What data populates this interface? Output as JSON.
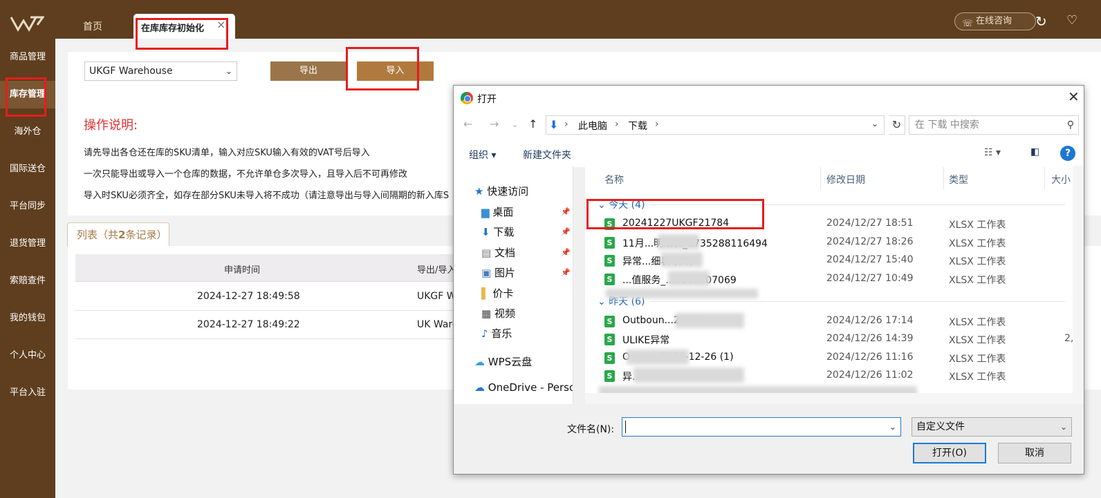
{
  "sidebar": {
    "items": [
      {
        "label": "商品管理"
      },
      {
        "label": "库存管理"
      },
      {
        "label": "海外仓"
      },
      {
        "label": "国际送仓"
      },
      {
        "label": "平台同步"
      },
      {
        "label": "退货管理"
      },
      {
        "label": "索赔查件"
      },
      {
        "label": "我的钱包"
      },
      {
        "label": "个人中心"
      },
      {
        "label": "平台入驻"
      }
    ]
  },
  "topbar": {
    "tab_home": "首页",
    "tab_active": "在库库存初始化",
    "tab_close": "×",
    "consult": "在线咨询"
  },
  "toolbar": {
    "warehouse": "UKGF Warehouse",
    "export_label": "导出",
    "import_label": "导入"
  },
  "instructions": {
    "title": "操作说明:",
    "lines": [
      "请先导出各仓还在库的SKU清单，输入对应SKU输入有效的VAT号后导入",
      "一次只能导出或导入一个仓库的数据，不允许单仓多次导入，且导入后不可再修改",
      "导入时SKU必须齐全，如存在部分SKU未导入将不成功（请注意导出与导入间隔期的新入库S"
    ]
  },
  "list": {
    "tab_prefix": "列表（共",
    "count": "2",
    "tab_suffix": "条记录）",
    "headers": [
      "申请时间",
      "导出/导入"
    ],
    "rows": [
      {
        "time": "2024-12-27 18:49:58",
        "warehouse": "UKGF W"
      },
      {
        "time": "2024-12-27 18:49:22",
        "warehouse": "UK Ware"
      }
    ]
  },
  "dialog": {
    "title": "打开",
    "path": [
      "此电脑",
      "下载"
    ],
    "search_placeholder": "在 下载 中搜索",
    "organize": "组织 ▾",
    "new_folder": "新建文件夹",
    "nav": {
      "quick_access": "快速访问",
      "items": [
        "桌面",
        "下载",
        "文档",
        "图片",
        "价卡",
        "视频",
        "音乐"
      ],
      "wps": "WPS云盘",
      "onedrive": "OneDrive - Perso"
    },
    "columns": [
      "名称",
      "修改日期",
      "类型",
      "大小"
    ],
    "groups": {
      "today": "今天 (4)",
      "yesterday": "昨天 (6)"
    },
    "files_today": [
      {
        "name": "20241227UKGF21784",
        "date": "2024/12/27 18:51",
        "type": "XLSX 工作表",
        "size": ""
      },
      {
        "name": "11月...明细表_1735288116494",
        "date": "2024/12/27 18:26",
        "type": "XLSX 工作表",
        "size": ""
      },
      {
        "name": "异常...细表 (28)",
        "date": "2024/12/27 15:40",
        "type": "XLSX 工作表",
        "size": ""
      },
      {
        "name": "...值服务_...5267707069",
        "date": "2024/12/27 10:49",
        "type": "XLSX 工作表",
        "size": ""
      }
    ],
    "files_yesterday": [
      {
        "name": "Outboun...26 (2)",
        "date": "2024/12/26 17:14",
        "type": "XLSX 工作表",
        "size": ""
      },
      {
        "name": "ULIKE异常",
        "date": "2024/12/26 14:39",
        "type": "XLSX 工作表",
        "size": "2,"
      },
      {
        "name": "O...un...2024-12-26 (1)",
        "date": "2024/12/26 11:16",
        "type": "XLSX 工作表",
        "size": ""
      },
      {
        "name": "异...",
        "date": "2024/12/26 11:02",
        "type": "XLSX 工作表",
        "size": ""
      }
    ],
    "filename_label": "文件名(N):",
    "filename_value": "",
    "filter": "自定义文件",
    "open_label": "打开(O)",
    "cancel_label": "取消"
  },
  "colors": {
    "sidebar": "#5e3e1e",
    "accent": "#b07a3e",
    "highlight": "#e81c1c",
    "link_blue": "#1c5fb0"
  }
}
